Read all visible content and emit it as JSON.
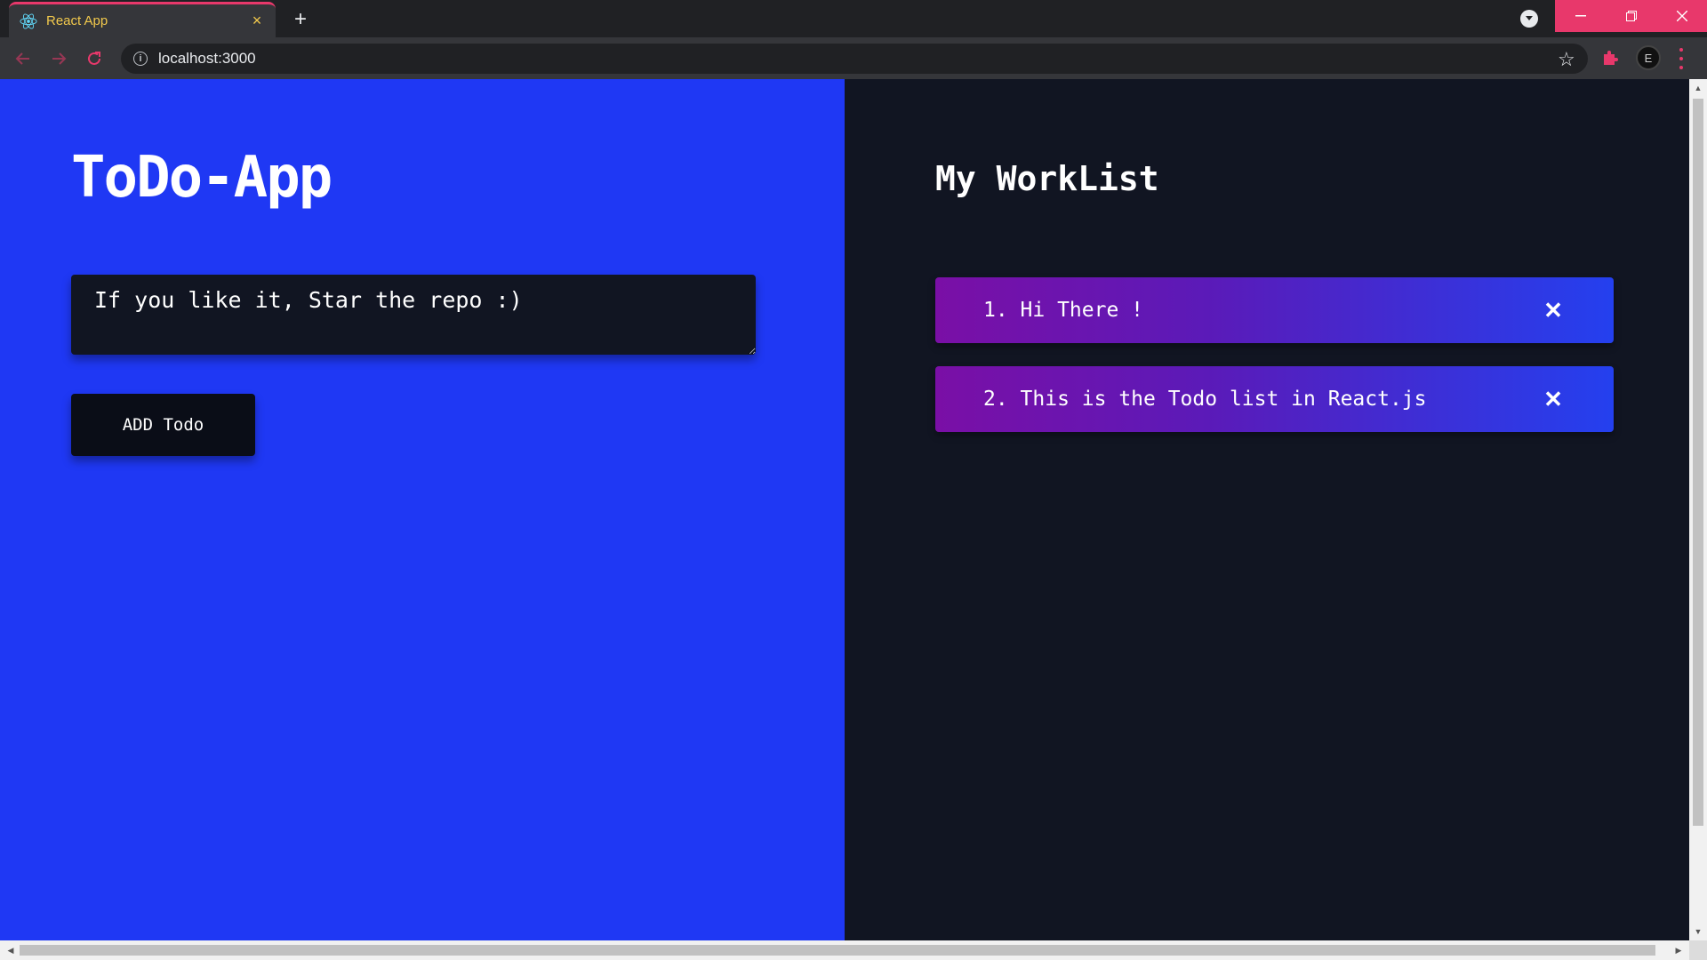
{
  "browser": {
    "tab_title": "React App",
    "tab_close_symbol": "×",
    "new_tab_symbol": "+",
    "url": "localhost:3000",
    "accent_color": "#e8386b",
    "tab_title_color": "#f2c94c",
    "icons": {
      "tab": "react-logo-icon",
      "back": "arrow-left-icon",
      "forward": "arrow-right-icon",
      "reload": "reload-icon",
      "site_info": "info-icon",
      "bookmark": "star-icon",
      "extensions": "puzzle-icon",
      "profile": "avatar",
      "menu": "kebab-menu-icon"
    }
  },
  "app": {
    "title": "ToDo-App",
    "input": {
      "value": "If you like it, Star the repo :)",
      "placeholder": ""
    },
    "add_button_label": "ADD Todo",
    "left_background": "#1f38f4",
    "right_background": "#111522"
  },
  "worklist": {
    "title": "My WorkList",
    "items": [
      {
        "text": "1. Hi There !",
        "delete_symbol": "✕"
      },
      {
        "text": "2. This is the Todo list in React.js",
        "delete_symbol": "✕"
      }
    ]
  }
}
